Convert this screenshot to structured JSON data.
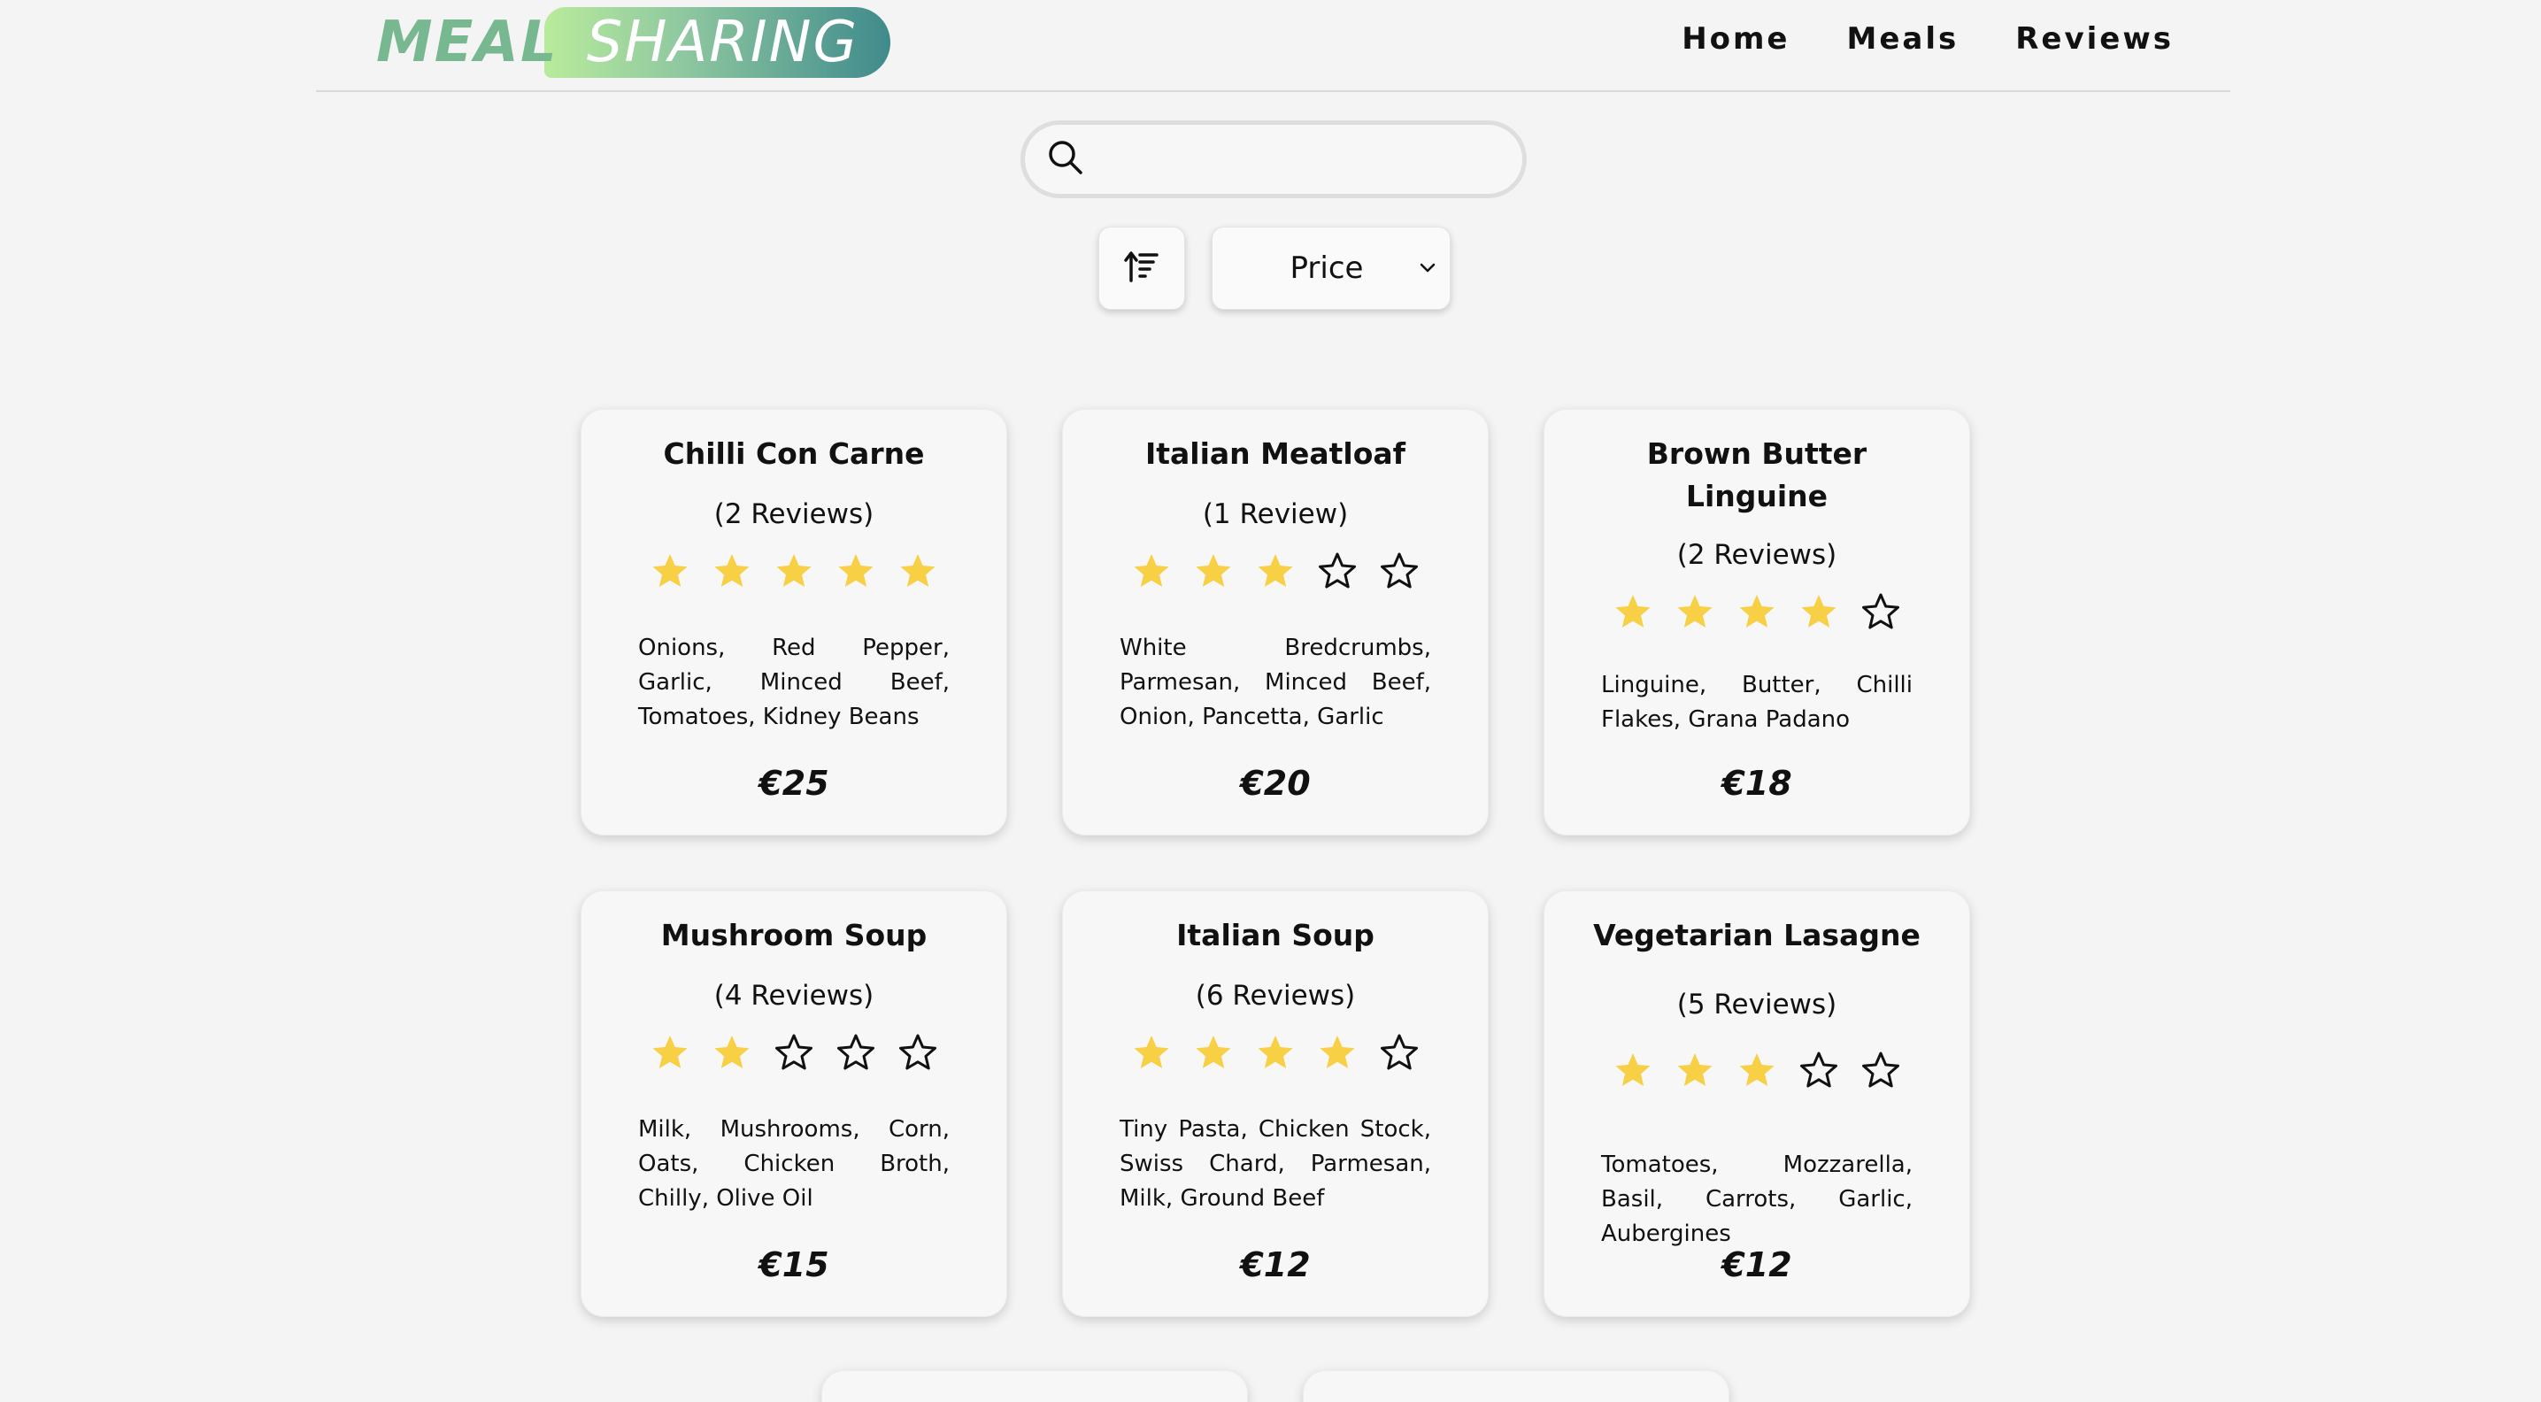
{
  "header": {
    "logo_left": "MEAL",
    "logo_right": "SHARING",
    "nav": [
      "Home",
      "Meals",
      "Reviews"
    ]
  },
  "search": {
    "placeholder": "",
    "value": ""
  },
  "sort": {
    "selected": "Price"
  },
  "icons": {
    "search": "search-icon",
    "sort": "sort-ascending-icon",
    "dropdown": "chevron-down-icon",
    "star": "star-icon"
  },
  "colors": {
    "star_filled": "#f7d046",
    "star_empty": "#111111"
  },
  "meals": [
    {
      "title": "Chilli Con Carne",
      "reviews": "(2 Reviews)",
      "rating": 5,
      "ingredients": "Onions, Red Pepper, Garlic, Minced Beef, Tomatoes, Kidney Beans",
      "price": "€25"
    },
    {
      "title": "Italian Meatloaf",
      "reviews": "(1 Review)",
      "rating": 3,
      "ingredients": "White Bredcrumbs, Parmesan, Minced Beef, Onion, Pancetta, Garlic",
      "price": "€20"
    },
    {
      "title": "Brown Butter Linguine",
      "reviews": "(2 Reviews)",
      "rating": 4,
      "ingredients": "Linguine, Butter, Chilli Flakes, Grana Padano",
      "price": "€18"
    },
    {
      "title": "Mushroom Soup",
      "reviews": "(4 Reviews)",
      "rating": 2,
      "ingredients": "Milk, Mushrooms, Corn, Oats, Chicken Broth, Chilly, Olive Oil",
      "price": "€15"
    },
    {
      "title": "Italian Soup",
      "reviews": "(6 Reviews)",
      "rating": 4,
      "ingredients": "Tiny Pasta, Chicken Stock, Swiss Chard, Parmesan, Milk, Ground Beef",
      "price": "€12"
    },
    {
      "title": "Vegetarian Lasagne",
      "reviews": "(5 Reviews)",
      "rating": 3,
      "ingredients": "Tomatoes, Mozzarella, Basil, Carrots, Garlic, Aubergines",
      "price": "€12"
    }
  ]
}
